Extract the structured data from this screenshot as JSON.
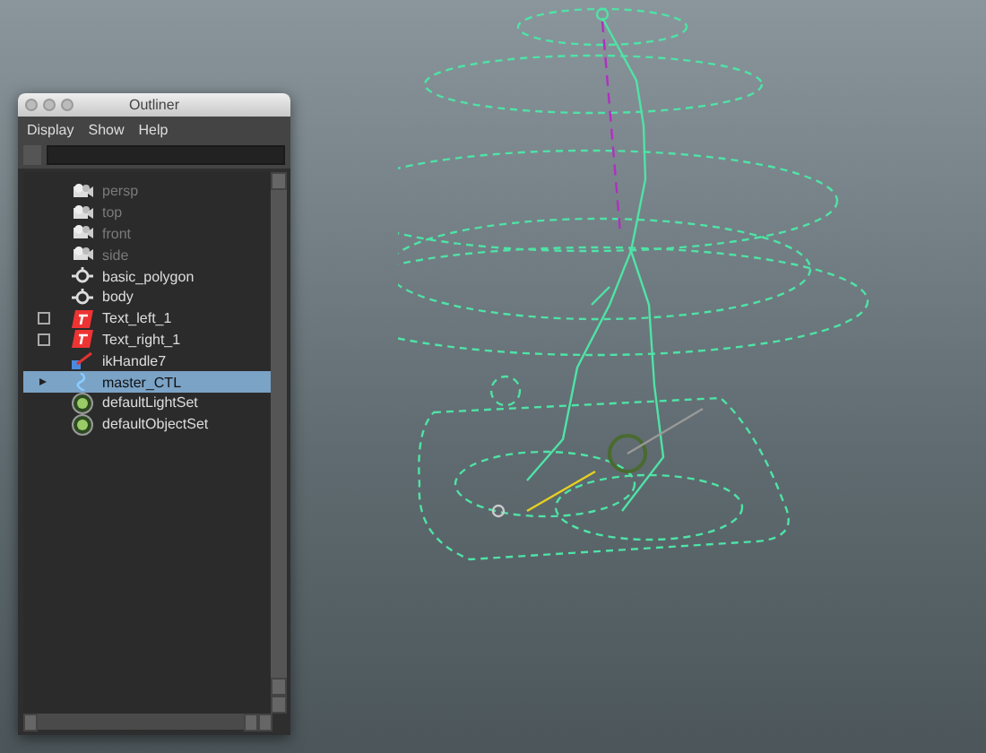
{
  "window": {
    "title": "Outliner"
  },
  "menu": [
    "Display",
    "Show",
    "Help"
  ],
  "items": [
    {
      "label": "persp",
      "kind": "camera",
      "hidden": true,
      "expandable": false,
      "selected": false
    },
    {
      "label": "top",
      "kind": "camera",
      "hidden": true,
      "expandable": false,
      "selected": false
    },
    {
      "label": "front",
      "kind": "camera",
      "hidden": true,
      "expandable": false,
      "selected": false
    },
    {
      "label": "side",
      "kind": "camera",
      "hidden": true,
      "expandable": false,
      "selected": false
    },
    {
      "label": "basic_polygon",
      "kind": "transform",
      "hidden": false,
      "expandable": false,
      "selected": false
    },
    {
      "label": "body",
      "kind": "transform",
      "hidden": false,
      "expandable": false,
      "selected": false
    },
    {
      "label": "Text_left_1",
      "kind": "text",
      "hidden": false,
      "checked": false,
      "expandable": false,
      "selected": false
    },
    {
      "label": "Text_right_1",
      "kind": "text",
      "hidden": false,
      "checked": false,
      "expandable": false,
      "selected": false
    },
    {
      "label": "ikHandle7",
      "kind": "ik",
      "hidden": false,
      "expandable": false,
      "selected": false
    },
    {
      "label": "master_CTL",
      "kind": "curve",
      "hidden": false,
      "expandable": true,
      "selected": true
    },
    {
      "label": "defaultLightSet",
      "kind": "set",
      "hidden": false,
      "expandable": false,
      "selected": false
    },
    {
      "label": "defaultObjectSet",
      "kind": "set",
      "hidden": false,
      "expandable": false,
      "selected": false
    }
  ]
}
